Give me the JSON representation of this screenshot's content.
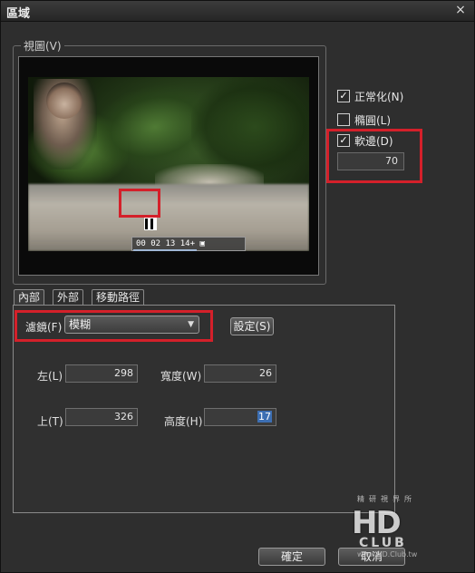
{
  "window": {
    "title": "區域",
    "close_glyph": "×"
  },
  "view_group": {
    "label": "視圖(V)",
    "timecode": "00 02 13 14+ ▣"
  },
  "options": {
    "normalize": {
      "label": "正常化(N)",
      "checked": true
    },
    "ellipse": {
      "label": "橢圓(L)",
      "checked": false
    },
    "feather": {
      "label": "軟邊(D)",
      "checked": true,
      "value": "70"
    }
  },
  "tabs": [
    {
      "label": "內部",
      "active": true
    },
    {
      "label": "外部",
      "active": false
    },
    {
      "label": "移動路徑",
      "active": false
    }
  ],
  "filter": {
    "label": "濾鏡(F)",
    "selected": "模糊",
    "settings_button": "設定(S)"
  },
  "coords": {
    "left_label": "左(L)",
    "left_value": "298",
    "width_label": "寬度(W)",
    "width_value": "26",
    "top_label": "上(T)",
    "top_value": "326",
    "height_label": "高度(H)",
    "height_value": "17"
  },
  "buttons": {
    "ok": "確定",
    "cancel": "取消"
  },
  "watermark": {
    "top": "精研視界所",
    "logo": "HD",
    "club": "CLUB",
    "url": "www.HD.Club.tw"
  },
  "colors": {
    "highlight_red": "#d4202a",
    "selection_blue": "#3d6fb3"
  }
}
